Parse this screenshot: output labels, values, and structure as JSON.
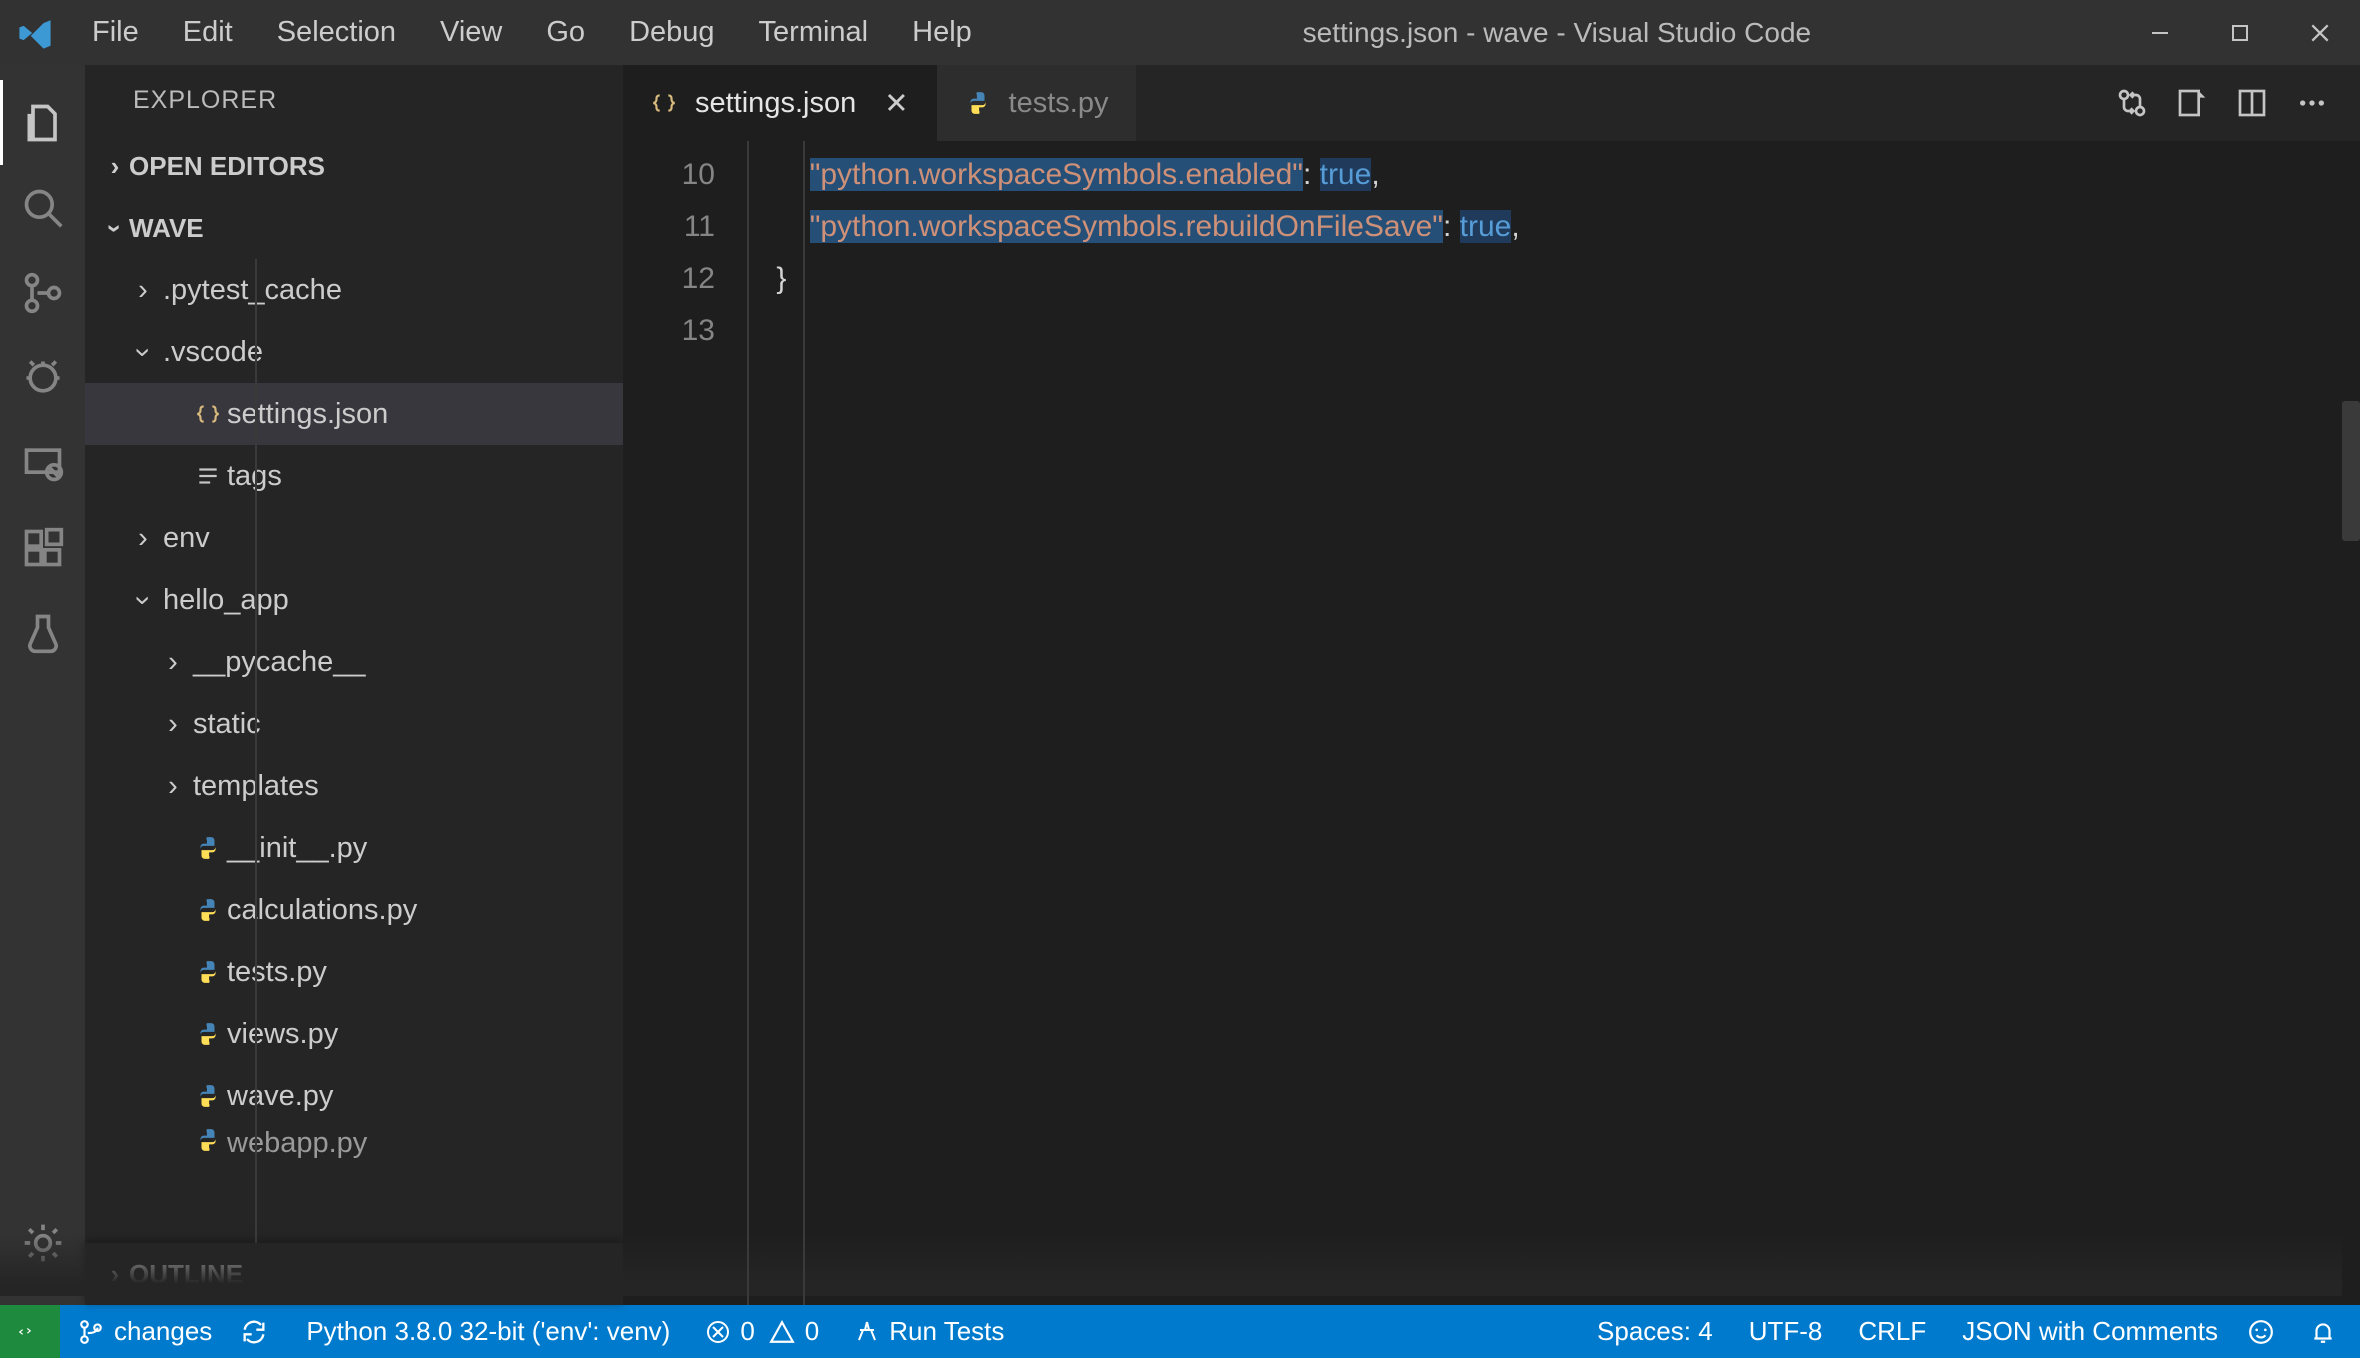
{
  "window": {
    "title": "settings.json - wave - Visual Studio Code",
    "menu": [
      "File",
      "Edit",
      "Selection",
      "View",
      "Go",
      "Debug",
      "Terminal",
      "Help"
    ]
  },
  "activity": {
    "items": [
      "explorer",
      "search",
      "source-control",
      "debug",
      "remote",
      "extensions",
      "testing"
    ]
  },
  "sidebar": {
    "title": "EXPLORER",
    "sections": {
      "open_editors": "OPEN EDITORS",
      "workspace": "WAVE",
      "outline": "OUTLINE"
    },
    "tree": [
      {
        "type": "folder",
        "name": ".pytest_cache",
        "depth": 0,
        "expanded": false
      },
      {
        "type": "folder",
        "name": ".vscode",
        "depth": 0,
        "expanded": true
      },
      {
        "type": "file",
        "name": "settings.json",
        "depth": 1,
        "icon": "json",
        "active": true
      },
      {
        "type": "file",
        "name": "tags",
        "depth": 1,
        "icon": "text"
      },
      {
        "type": "folder",
        "name": "env",
        "depth": 0,
        "expanded": false
      },
      {
        "type": "folder",
        "name": "hello_app",
        "depth": 0,
        "expanded": true
      },
      {
        "type": "folder",
        "name": "__pycache__",
        "depth": 1,
        "expanded": false
      },
      {
        "type": "folder",
        "name": "static",
        "depth": 1,
        "expanded": false
      },
      {
        "type": "folder",
        "name": "templates",
        "depth": 1,
        "expanded": false
      },
      {
        "type": "file",
        "name": "__init__.py",
        "depth": 1,
        "icon": "python"
      },
      {
        "type": "file",
        "name": "calculations.py",
        "depth": 1,
        "icon": "python"
      },
      {
        "type": "file",
        "name": "tests.py",
        "depth": 1,
        "icon": "python"
      },
      {
        "type": "file",
        "name": "views.py",
        "depth": 1,
        "icon": "python"
      },
      {
        "type": "file",
        "name": "wave.py",
        "depth": 1,
        "icon": "python"
      },
      {
        "type": "file",
        "name": "webapp.py",
        "depth": 1,
        "icon": "python",
        "cut": true
      }
    ]
  },
  "tabs": [
    {
      "label": "settings.json",
      "icon": "json",
      "active": true,
      "closable": true
    },
    {
      "label": "tests.py",
      "icon": "python",
      "active": false,
      "closable": false
    }
  ],
  "editor": {
    "lines": [
      {
        "n": 10,
        "indent": 2,
        "tokens": [
          {
            "t": "str",
            "v": "\"python.workspaceSymbols.enabled\"",
            "hl": true
          },
          {
            "t": "pun",
            "v": ": "
          },
          {
            "t": "kw",
            "v": "true",
            "hl": true
          },
          {
            "t": "pun",
            "v": ","
          }
        ]
      },
      {
        "n": 11,
        "indent": 2,
        "tokens": [
          {
            "t": "str",
            "v": "\"python.workspaceSymbols.rebuildOnFileSave\"",
            "hl": true
          },
          {
            "t": "pun",
            "v": ": "
          },
          {
            "t": "kw",
            "v": "true",
            "hl": true
          },
          {
            "t": "pun",
            "v": ","
          }
        ]
      },
      {
        "n": 12,
        "indent": 1,
        "tokens": [
          {
            "t": "pun",
            "v": "}"
          }
        ]
      },
      {
        "n": 13,
        "indent": 0,
        "tokens": []
      }
    ]
  },
  "status": {
    "branch": "changes",
    "python": "Python 3.8.0 32-bit ('env': venv)",
    "errors": "0",
    "warnings": "0",
    "run": "Run Tests",
    "spaces": "Spaces: 4",
    "encoding": "UTF-8",
    "eol": "CRLF",
    "lang": "JSON with Comments"
  }
}
